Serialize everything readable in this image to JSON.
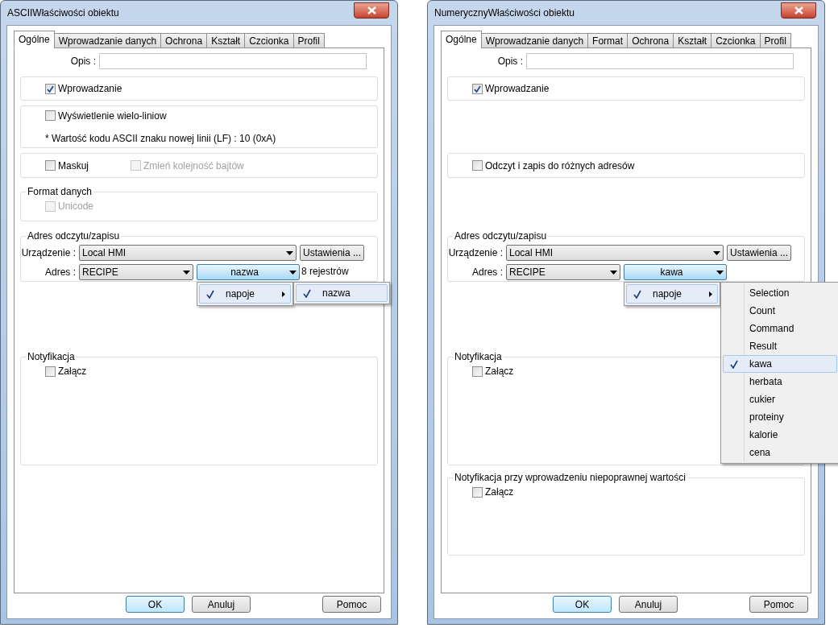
{
  "dialogs": [
    {
      "title": "ASCIIWłaściwości obiektu",
      "tabs": [
        {
          "label": "Ogólne",
          "selected": true
        },
        {
          "label": "Wprowadzanie danych",
          "selected": false
        },
        {
          "label": "Ochrona",
          "selected": false
        },
        {
          "label": "Kształt",
          "selected": false
        },
        {
          "label": "Czcionka",
          "selected": false
        },
        {
          "label": "Profil",
          "selected": false
        }
      ],
      "description_label": "Opis :",
      "sections": [
        {
          "kind": "checks",
          "checks": [
            {
              "label": "Wprowadzanie",
              "checked": true,
              "disabled": false
            }
          ]
        },
        {
          "kind": "checks",
          "checks": [
            {
              "label": "Wyświetlenie wielo-liniow",
              "checked": false,
              "disabled": false
            }
          ],
          "note": "* Wartość kodu ASCII znaku nowej linii (LF) : 10 (0xA)"
        },
        {
          "kind": "checks",
          "checks": [
            {
              "label": "Maskuj",
              "checked": false,
              "disabled": false
            },
            {
              "label": "Zmień kolejność bajtów",
              "checked": false,
              "disabled": true
            }
          ]
        },
        {
          "kind": "group",
          "title": "Format danych",
          "checks": [
            {
              "label": "Unicode",
              "checked": false,
              "disabled": true
            }
          ]
        },
        {
          "kind": "address",
          "title": "Adres odczytu/zapisu",
          "device_label": "Urządzenie :",
          "device": "Local HMI",
          "settings_button": "Ustawienia ...",
          "address_label": "Adres :",
          "address": "RECIPE",
          "field": "nazwa",
          "info": "8 rejestrów",
          "menu": [
            {
              "label": "napoje",
              "checked": true
            }
          ],
          "submenu": [
            {
              "label": "nazwa",
              "checked": true
            }
          ]
        },
        {
          "kind": "group",
          "title": "Notyfikacja",
          "checks": [
            {
              "label": "Załącz",
              "checked": false,
              "disabled": false
            }
          ]
        }
      ],
      "buttons": [
        {
          "label": "OK",
          "default": true
        },
        {
          "label": "Anuluj",
          "default": false
        },
        {
          "label": "Pomoc",
          "default": false
        }
      ]
    },
    {
      "title": "NumerycznyWłaściwości obiektu",
      "tabs": [
        {
          "label": "Ogólne",
          "selected": true
        },
        {
          "label": "Wprowadzanie danych",
          "selected": false
        },
        {
          "label": "Format",
          "selected": false
        },
        {
          "label": "Ochrona",
          "selected": false
        },
        {
          "label": "Kształt",
          "selected": false
        },
        {
          "label": "Czcionka",
          "selected": false
        },
        {
          "label": "Profil",
          "selected": false
        }
      ],
      "description_label": "Opis :",
      "sections": [
        {
          "kind": "checks",
          "checks": [
            {
              "label": "Wprowadzanie",
              "checked": true,
              "disabled": false
            }
          ]
        },
        {
          "kind": "checks",
          "checks": [
            {
              "label": "Odczyt i zapis do różnych adresów",
              "checked": false,
              "disabled": false
            }
          ]
        },
        {
          "kind": "address",
          "title": "Adres odczytu/zapisu",
          "device_label": "Urządzenie :",
          "device": "Local HMI",
          "settings_button": "Ustawienia ...",
          "address_label": "Adres :",
          "address": "RECIPE",
          "field": "kawa",
          "menu": [
            {
              "label": "napoje",
              "checked": true
            }
          ],
          "submenu": [
            {
              "label": "Selection",
              "checked": false
            },
            {
              "label": "Count",
              "checked": false
            },
            {
              "label": "Command",
              "checked": false
            },
            {
              "label": "Result",
              "checked": false
            },
            {
              "label": "kawa",
              "checked": true
            },
            {
              "label": "herbata",
              "checked": false
            },
            {
              "label": "cukier",
              "checked": false
            },
            {
              "label": "proteiny",
              "checked": false
            },
            {
              "label": "kalorie",
              "checked": false
            },
            {
              "label": "cena",
              "checked": false
            }
          ]
        },
        {
          "kind": "group",
          "title": "Notyfikacja",
          "checks": [
            {
              "label": "Załącz",
              "checked": false,
              "disabled": false
            }
          ]
        },
        {
          "kind": "group",
          "title": "Notyfikacja przy wprowadzeniu niepoprawnej wartości",
          "checks": [
            {
              "label": "Załącz",
              "checked": false,
              "disabled": false
            }
          ]
        }
      ],
      "buttons": [
        {
          "label": "OK",
          "default": true
        },
        {
          "label": "Anuluj",
          "default": false
        },
        {
          "label": "Pomoc",
          "default": false
        }
      ]
    }
  ]
}
